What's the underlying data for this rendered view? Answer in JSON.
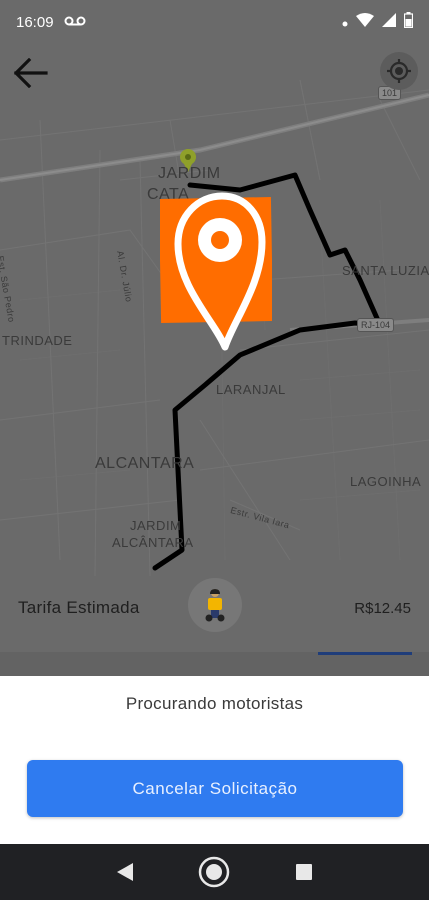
{
  "status_bar": {
    "time": "16:09",
    "left_icon": "voicemail-icon",
    "right_icons": [
      "dot-icon",
      "wifi-icon",
      "signal-icon",
      "battery-icon"
    ]
  },
  "map": {
    "labels": {
      "jardim_catarina_1": "JARDIM",
      "jardim_catarina_2": "CATA",
      "santa_luzia": "SANTA LUZIA",
      "trindade": "TRINDADE",
      "laranjal": "LARANJAL",
      "alcantara": "ALCANTARA",
      "lagoinha": "LAGOINHA",
      "jardim_alcantara_1": "JARDIM",
      "jardim_alcantara_2": "ALCÂNTARA",
      "road_rj104": "RJ-104",
      "road_101": "101",
      "street_1": "Al. Dr. Júlio",
      "street_2": "Est. São Pedro",
      "street_3": "Estr. Vila Iara"
    },
    "pin_color": "#FF6D00",
    "route_color": "#000000"
  },
  "top_controls": {
    "back_icon": "arrow-left-icon",
    "locate_icon": "crosshair-location-icon"
  },
  "fare": {
    "label": "Tarifa Estimada",
    "vehicle_icon": "motorcycle-courier-icon",
    "price": "R$12.45"
  },
  "sheet": {
    "status_text": "Procurando motoristas",
    "cancel_label": "Cancelar Solicitação",
    "accent_color": "#2F7BF0"
  },
  "nav_bar": {
    "back_icon": "triangle-back-icon",
    "home_icon": "circle-home-icon",
    "recents_icon": "square-recents-icon"
  }
}
